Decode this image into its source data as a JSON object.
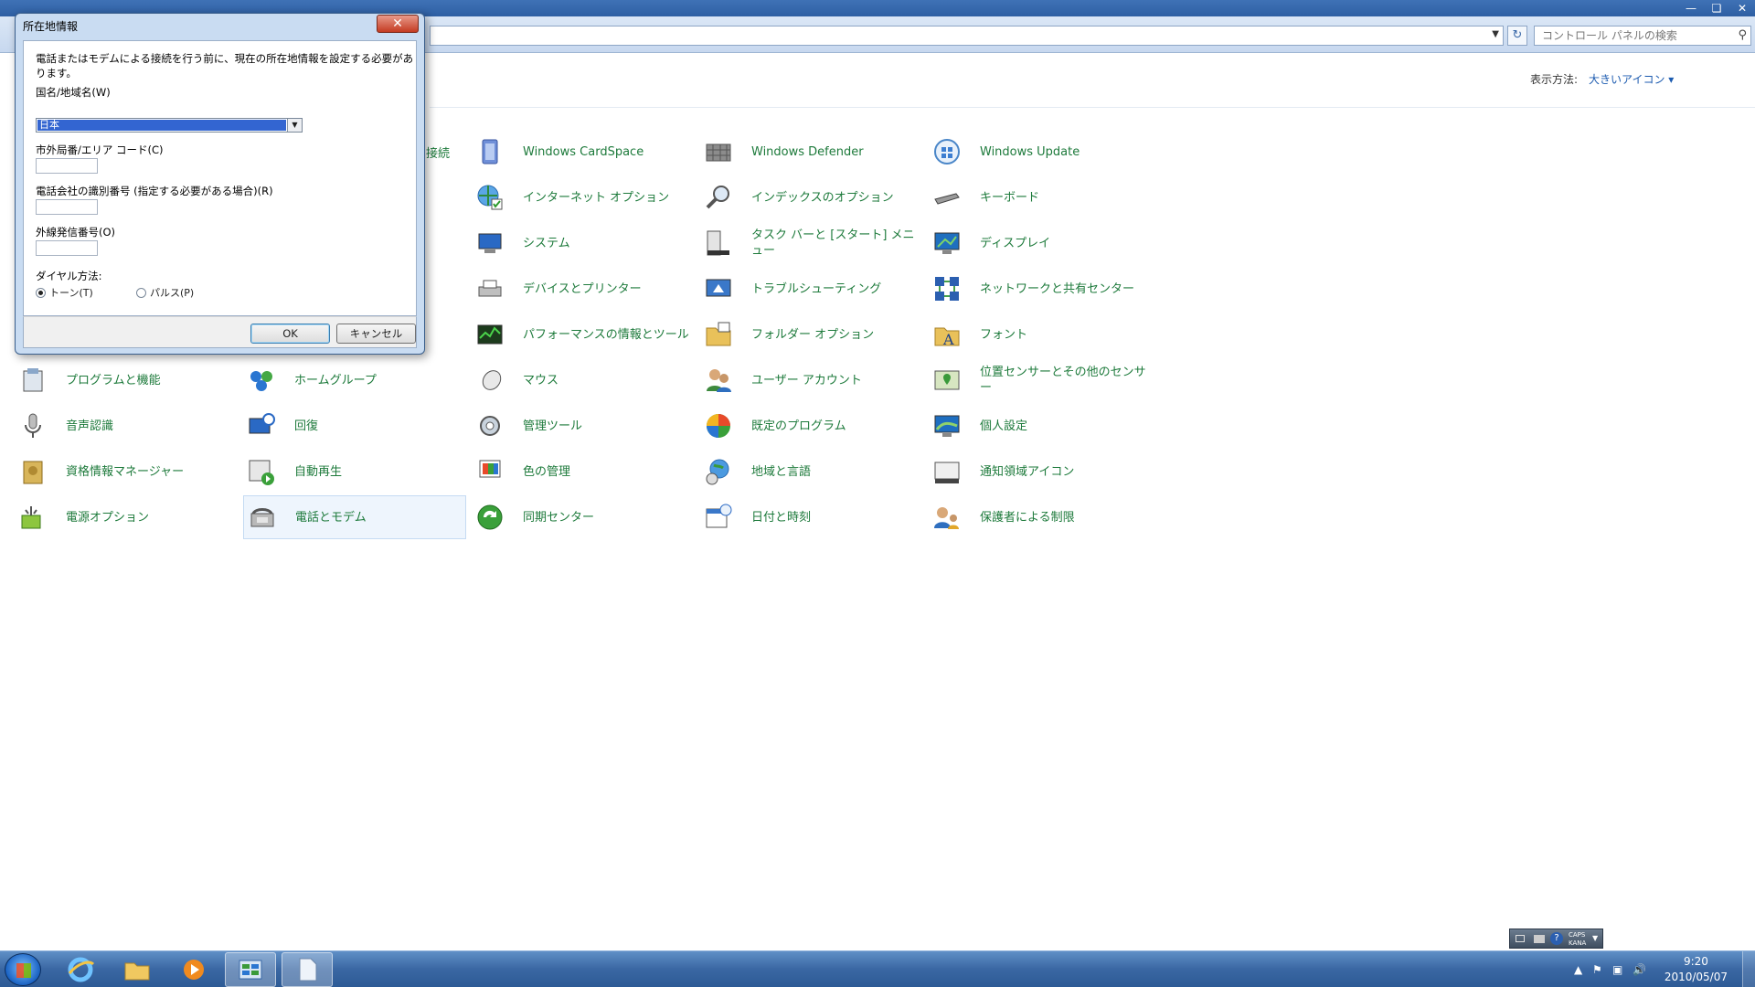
{
  "window": {
    "search_placeholder": "コントロール パネルの検索",
    "view_by_label": "表示方法:",
    "view_by_value": "大きいアイコン ▾"
  },
  "partial_label": "接続",
  "items": [
    {
      "label": "Windows CardSpace",
      "icon": "cardspace-icon"
    },
    {
      "label": "Windows Defender",
      "icon": "defender-icon"
    },
    {
      "label": "Windows Update",
      "icon": "windows-update-icon"
    },
    {
      "label": "インターネット オプション",
      "icon": "internet-options-icon"
    },
    {
      "label": "インデックスのオプション",
      "icon": "indexing-icon"
    },
    {
      "label": "キーボード",
      "icon": "keyboard-icon"
    },
    {
      "label": "システム",
      "icon": "system-icon"
    },
    {
      "label": "タスク バーと [スタート] メニュー",
      "icon": "taskbar-start-icon"
    },
    {
      "label": "ディスプレイ",
      "icon": "display-icon"
    },
    {
      "label": "デバイスとプリンター",
      "icon": "devices-printers-icon"
    },
    {
      "label": "トラブルシューティング",
      "icon": "troubleshooting-icon"
    },
    {
      "label": "ネットワークと共有センター",
      "icon": "network-sharing-icon"
    },
    {
      "label": "パフォーマンスの情報とツール",
      "icon": "performance-icon"
    },
    {
      "label": "フォルダー オプション",
      "icon": "folder-options-icon"
    },
    {
      "label": "フォント",
      "icon": "fonts-icon"
    },
    {
      "label": "プログラムと機能",
      "icon": "programs-features-icon"
    },
    {
      "label": "ホームグループ",
      "icon": "homegroup-icon"
    },
    {
      "label": "マウス",
      "icon": "mouse-icon"
    },
    {
      "label": "ユーザー アカウント",
      "icon": "user-accounts-icon"
    },
    {
      "label": "位置センサーとその他のセンサー",
      "icon": "location-sensors-icon"
    },
    {
      "label": "音声認識",
      "icon": "speech-recognition-icon"
    },
    {
      "label": "回復",
      "icon": "recovery-icon"
    },
    {
      "label": "管理ツール",
      "icon": "admin-tools-icon"
    },
    {
      "label": "既定のプログラム",
      "icon": "default-programs-icon"
    },
    {
      "label": "個人設定",
      "icon": "personalization-icon"
    },
    {
      "label": "資格情報マネージャー",
      "icon": "credential-manager-icon"
    },
    {
      "label": "自動再生",
      "icon": "autoplay-icon"
    },
    {
      "label": "色の管理",
      "icon": "color-management-icon"
    },
    {
      "label": "地域と言語",
      "icon": "region-language-icon"
    },
    {
      "label": "通知領域アイコン",
      "icon": "notification-icons-icon"
    },
    {
      "label": "電源オプション",
      "icon": "power-options-icon"
    },
    {
      "label": "電話とモデム",
      "icon": "phone-modem-icon"
    },
    {
      "label": "同期センター",
      "icon": "sync-center-icon"
    },
    {
      "label": "日付と時刻",
      "icon": "date-time-icon"
    },
    {
      "label": "保護者による制限",
      "icon": "parental-controls-icon"
    }
  ],
  "dialog": {
    "title": "所在地情報",
    "intro": "電話またはモデムによる接続を行う前に、現在の所在地情報を設定する必要があります。",
    "country_label": "国名/地域名(W)",
    "country_value": "日本",
    "area_code_label": "市外局番/エリア コード(C)",
    "area_code_value": "",
    "carrier_label": "電話会社の識別番号 (指定する必要がある場合)(R)",
    "carrier_value": "",
    "outside_line_label": "外線発信番号(O)",
    "outside_line_value": "",
    "dial_label": "ダイヤル方法:",
    "tone_label": "トーン(T)",
    "pulse_label": "パルス(P)",
    "dial_selected": "tone",
    "ok_label": "OK",
    "cancel_label": "キャンセル"
  },
  "tray": {
    "time": "9:20",
    "date": "2010/05/07",
    "caps": "CAPS",
    "kana": "KANA"
  }
}
